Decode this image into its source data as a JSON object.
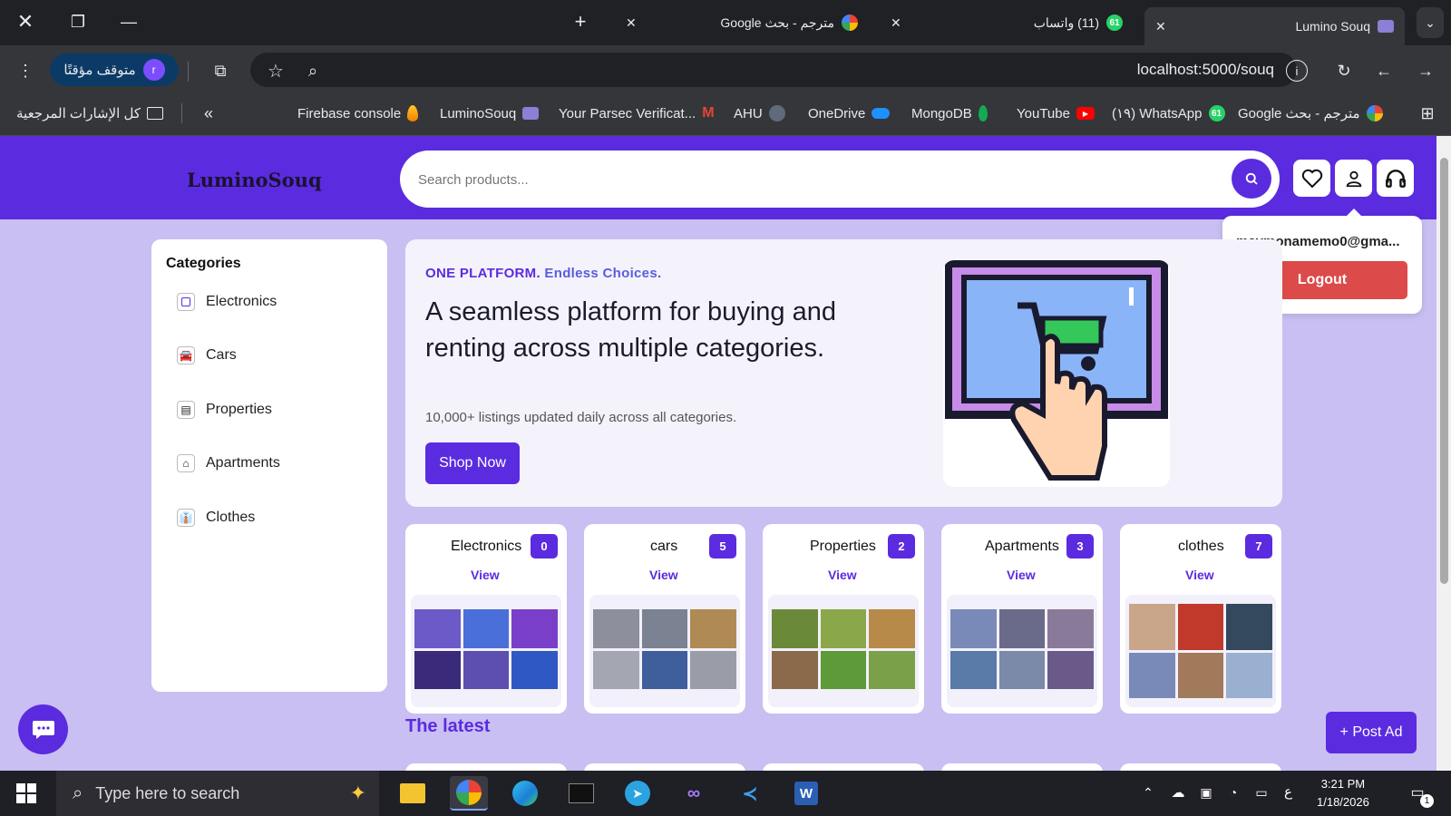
{
  "browser": {
    "tabs": [
      {
        "label": "Lumino Souq",
        "active": true
      },
      {
        "label": "(11) واتساب",
        "count": "61"
      },
      {
        "label": "مترجم - بحث Google"
      }
    ],
    "profile_status": "متوقف مؤقتًا",
    "profile_initial": "r",
    "url": "localhost:5000/souq",
    "all_bookmarks": "كل الإشارات المرجعية",
    "bookmarks": [
      {
        "label": "مترجم - بحث Google",
        "icon": "google-icon"
      },
      {
        "label": "WhatsApp (١٩)",
        "icon": "whatsapp-icon",
        "badge": "61"
      },
      {
        "label": "YouTube",
        "icon": "youtube-icon"
      },
      {
        "label": "MongoDB",
        "icon": "mongodb-icon"
      },
      {
        "label": "OneDrive",
        "icon": "onedrive-icon"
      },
      {
        "label": "AHU",
        "icon": "ahu-icon"
      },
      {
        "label": "Your Parsec Verificat...",
        "icon": "gmail-icon"
      },
      {
        "label": "LuminoSouq",
        "icon": "lumino-icon"
      },
      {
        "label": "Firebase console",
        "icon": "firebase-icon"
      }
    ]
  },
  "header": {
    "logo": "LuminoSouq",
    "search_placeholder": "Search products..."
  },
  "account_dropdown": {
    "email": "maymonamemo0@gma...",
    "logout_label": "Logout"
  },
  "sidebar": {
    "title": "Categories",
    "items": [
      {
        "label": "Electronics",
        "icon": "square-icon"
      },
      {
        "label": "Cars",
        "icon": "car-icon"
      },
      {
        "label": "Properties",
        "icon": "building-icon"
      },
      {
        "label": "Apartments",
        "icon": "house-icon"
      },
      {
        "label": "Clothes",
        "icon": "clothes-icon"
      }
    ]
  },
  "hero": {
    "tagline_bold": "ONE PLATFORM.",
    "tagline_rest": "Endless Choices.",
    "heading": "A seamless platform for buying and renting across multiple categories.",
    "subtext": "10,000+ listings updated daily across all categories.",
    "cta_label": "Shop Now"
  },
  "category_cards": [
    {
      "name": "Electronics",
      "count": "0",
      "view": "View"
    },
    {
      "name": "cars",
      "count": "5",
      "view": "View"
    },
    {
      "name": "Properties",
      "count": "2",
      "view": "View"
    },
    {
      "name": "Apartments",
      "count": "3",
      "view": "View"
    },
    {
      "name": "clothes",
      "count": "7",
      "view": "View"
    }
  ],
  "latest_title": "The latest",
  "post_ad_label": "+ Post Ad",
  "taskbar": {
    "search_placeholder": "Type here to search",
    "time": "3:21 PM",
    "date": "1/18/2026",
    "lang": "ع",
    "notif_count": "1"
  },
  "colors": {
    "primary": "#5b2be0",
    "background": "#c9bff2",
    "logout": "#dc4a4a"
  }
}
